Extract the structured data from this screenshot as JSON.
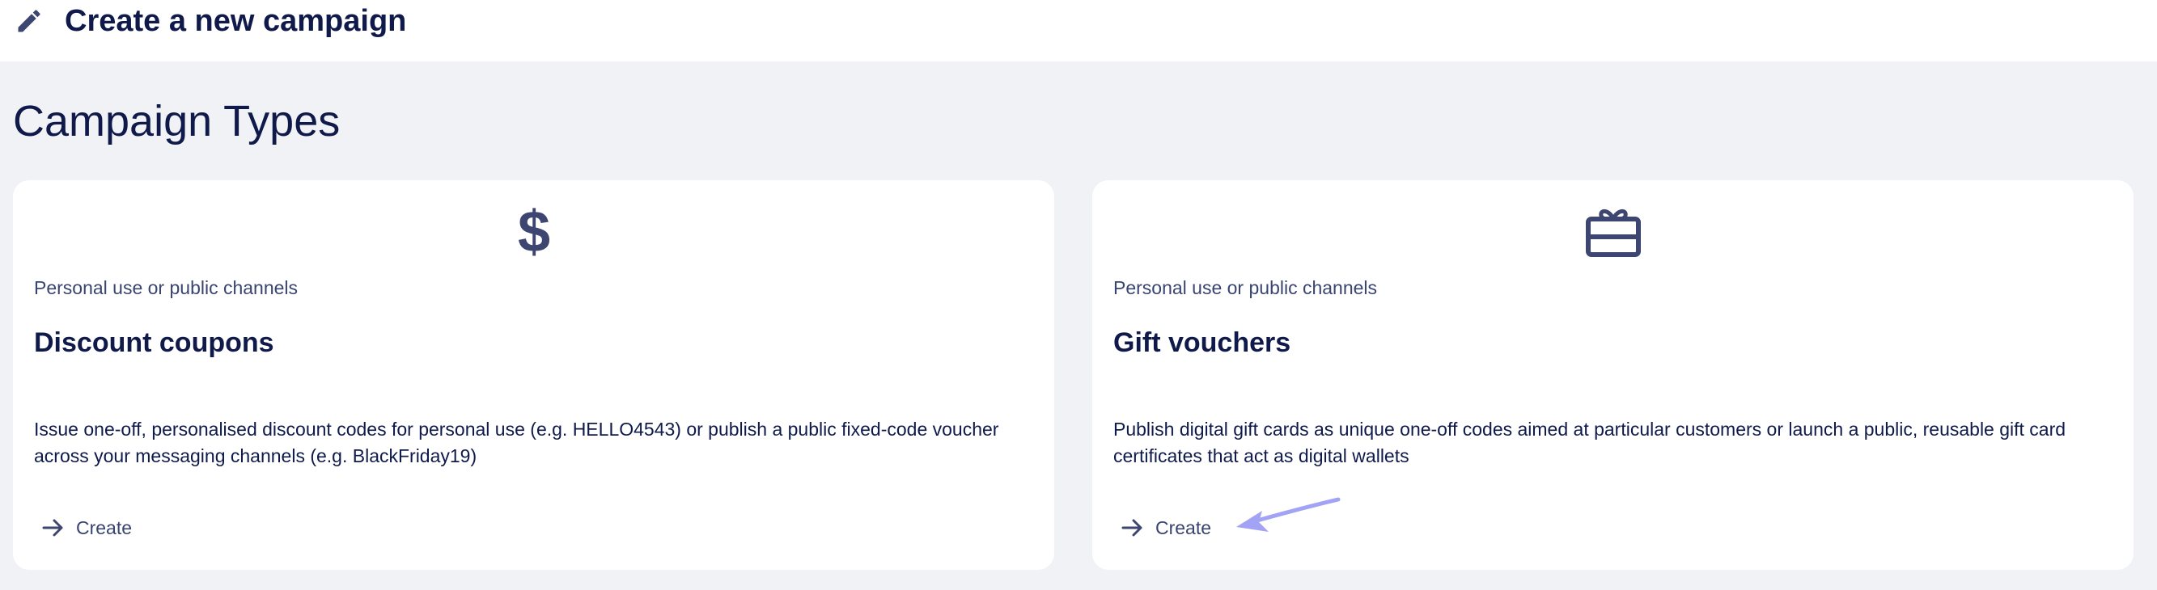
{
  "header": {
    "title": "Create a new campaign",
    "icon": "pencil-icon"
  },
  "section": {
    "title": "Campaign Types"
  },
  "cards": [
    {
      "icon": "dollar-icon",
      "subtitle": "Personal use or public channels",
      "name": "Discount coupons",
      "description": "Issue one-off, personalised discount codes for personal use (e.g. HELLO4543) or publish a public fixed-code voucher across your messaging channels (e.g. BlackFriday19)",
      "action_label": "Create"
    },
    {
      "icon": "gift-card-icon",
      "subtitle": "Personal use or public channels",
      "name": "Gift vouchers",
      "description": "Publish digital gift cards as unique one-off codes aimed at particular customers or launch a public, reusable gift card certificates that act as digital wallets",
      "action_label": "Create"
    }
  ],
  "colors": {
    "primary_text": "#0f1a4a",
    "secondary_text": "#3a4470",
    "icon": "#3d4670",
    "annotation_arrow": "#a3a3f5",
    "background": "#f1f2f6"
  }
}
